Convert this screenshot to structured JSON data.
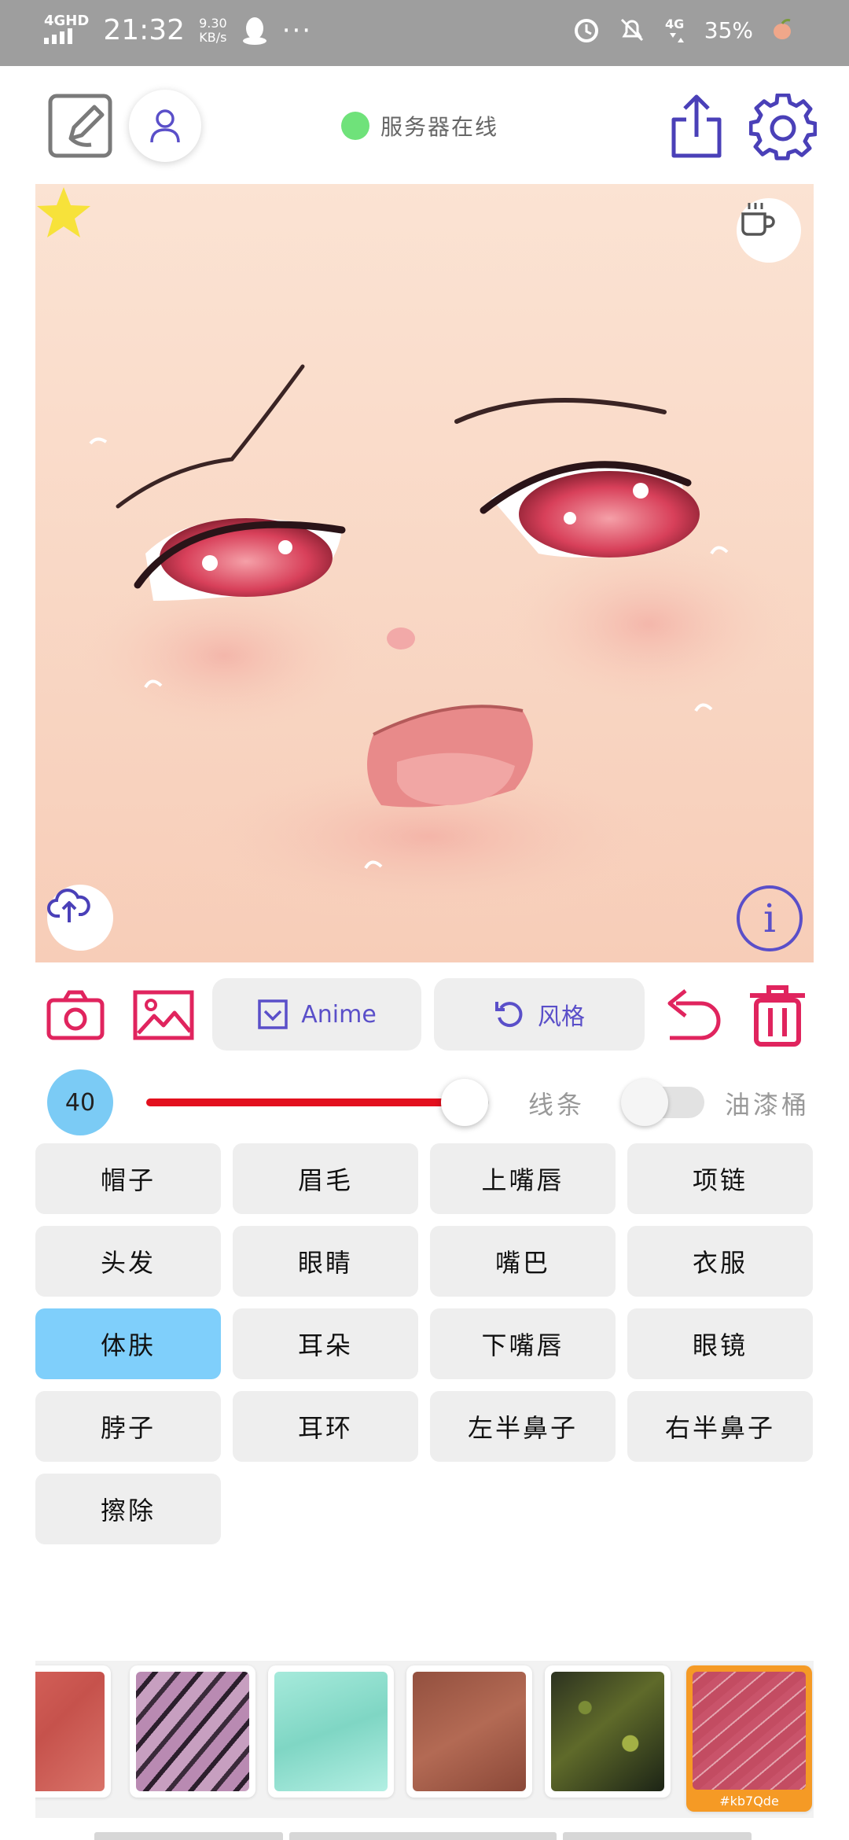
{
  "status_bar": {
    "network": "4GHD",
    "time": "21:32",
    "speed_value": "9.30",
    "speed_unit": "KB/s",
    "more": "···",
    "battery": "35%",
    "icons": [
      "signal-icon",
      "qq-icon",
      "alarm-icon",
      "mute-icon",
      "4g-icon",
      "battery-icon"
    ]
  },
  "toolbar": {
    "server_status": "服务器在线",
    "server_color": "#6fe27a",
    "icons": [
      "draw-icon",
      "user-icon",
      "share-icon",
      "gear-icon"
    ]
  },
  "canvas": {
    "icons": [
      "star-icon",
      "coffee-icon",
      "upload-icon",
      "info-icon"
    ],
    "info_glyph": "i"
  },
  "actions": {
    "anime_label": "Anime",
    "style_label": "风格",
    "icons": [
      "camera-icon",
      "image-icon",
      "checkbox-icon",
      "refresh-icon",
      "undo-icon",
      "trash-icon"
    ],
    "accent_color": "#e0245e"
  },
  "brush": {
    "size": "40",
    "slider_fraction": 0.93,
    "line_label": "线条",
    "bucket_label": "油漆桶",
    "bucket_enabled": false,
    "track_color": "#e3101e"
  },
  "parts": {
    "items": [
      "帽子",
      "眉毛",
      "上嘴唇",
      "项链",
      "头发",
      "眼睛",
      "嘴巴",
      "衣服",
      "体肤",
      "耳朵",
      "下嘴唇",
      "眼镜",
      "脖子",
      "耳环",
      "左半鼻子",
      "右半鼻子",
      "擦除"
    ],
    "selected": "体肤"
  },
  "textures": {
    "selected_code": "#kb7Qde",
    "count": 6
  }
}
